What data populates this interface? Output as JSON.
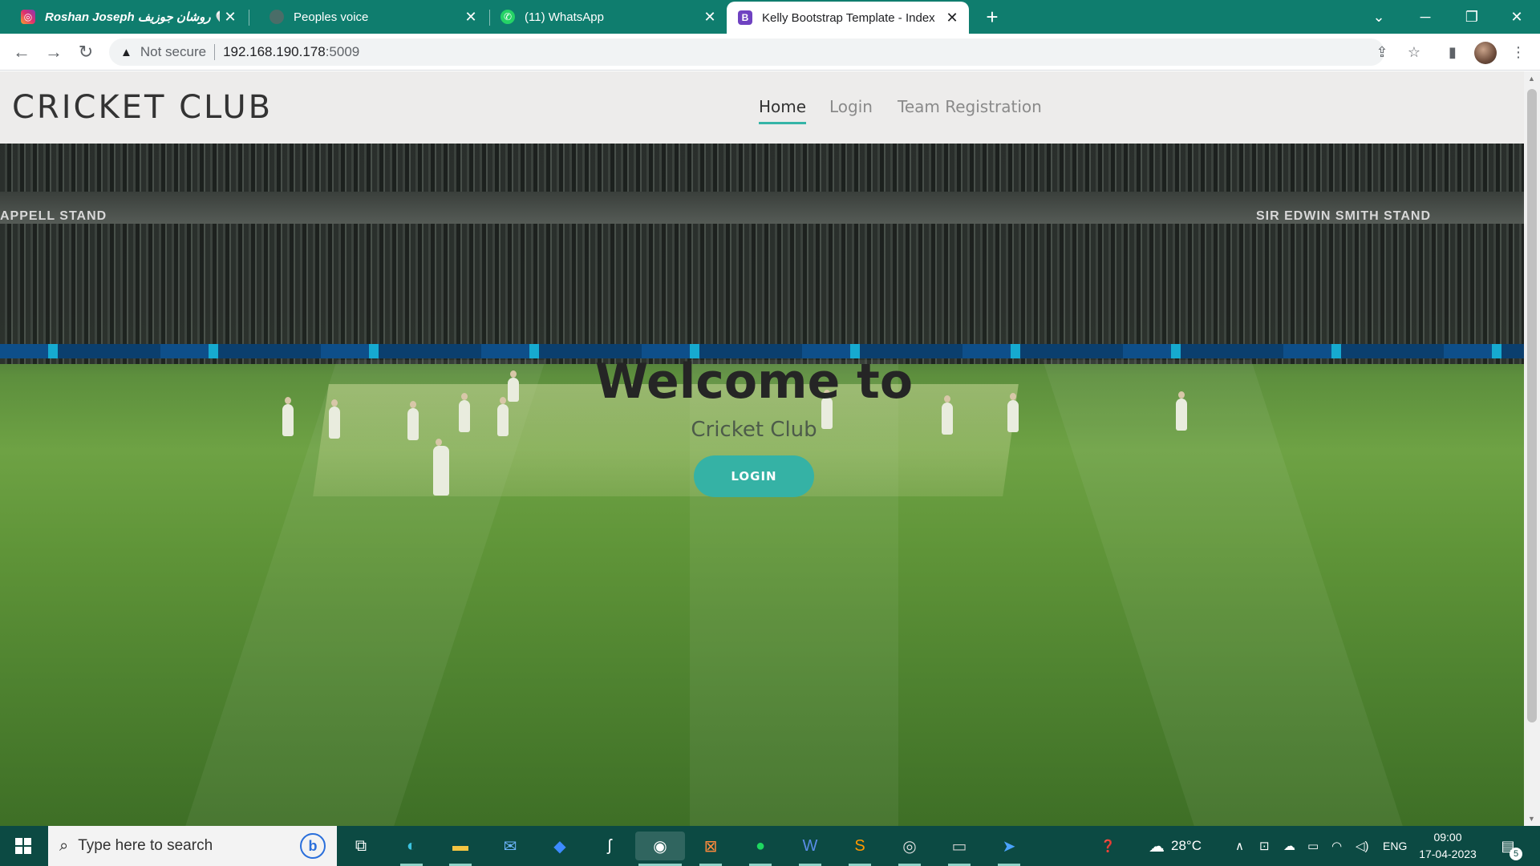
{
  "browser": {
    "tabs": [
      {
        "title": "Roshan Joseph روشان جوزيف 🤍",
        "icon": "instagram-icon"
      },
      {
        "title": "Peoples voice",
        "icon": "globe-icon"
      },
      {
        "title": "(11) WhatsApp",
        "icon": "whatsapp-icon"
      },
      {
        "title": "Kelly Bootstrap Template - Index",
        "icon": "bootstrap-icon",
        "favicon_letter": "B"
      }
    ],
    "address": {
      "security_label": "Not secure",
      "host": "192.168.190.178",
      "port": ":5009"
    }
  },
  "site": {
    "brand": "CRICKET CLUB",
    "nav": [
      {
        "label": "Home",
        "active": true
      },
      {
        "label": "Login",
        "active": false
      },
      {
        "label": "Team Registration",
        "active": false
      }
    ],
    "hero": {
      "title": "Welcome to",
      "subtitle": "Cricket Club",
      "button": "LOGIN"
    },
    "stadium_signs": {
      "left": "APPELL STAND",
      "right": "SIR EDWIN SMITH STAND"
    },
    "accent_color": "#35b2a5"
  },
  "taskbar": {
    "search_placeholder": "Type here to search",
    "weather": "28°C",
    "language": "ENG",
    "time": "09:00",
    "date": "17-04-2023",
    "notification_count": "5"
  }
}
